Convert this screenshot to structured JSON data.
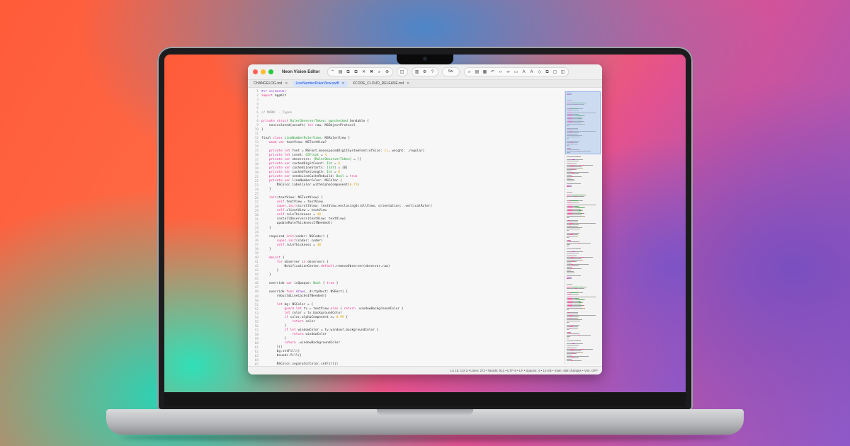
{
  "window": {
    "title": "Neon Vision Editor",
    "colors": {
      "close": "#ff5f57",
      "minimize": "#febc2e",
      "zoom": "#28c840"
    }
  },
  "toolbar": {
    "group_a": [
      "chevron-up-icon",
      "folder-icon",
      "copy-icon",
      "copy-icon",
      "trash-icon",
      "close-icon",
      "search-icon",
      "zoom-icon"
    ],
    "group_b": [
      "sidebar-icon"
    ],
    "group_c": [
      "split-icon",
      "gear-icon",
      "help-icon"
    ],
    "language": "Sw",
    "group_d": [
      "search-icon",
      "doc-icon",
      "book-icon",
      "undo-icon",
      "code-icon",
      "link-icon",
      "screen-icon",
      "text-a-icon",
      "text-a-icon",
      "eraser-icon",
      "copy-icon",
      "frame-icon",
      "sidebar-icon"
    ]
  },
  "tabs": [
    {
      "label": "CHANGELOG.md",
      "active": false
    },
    {
      "label": "LineNumberRulerView.swift",
      "active": true
    },
    {
      "label": "XCODE_CLOUD_RELEASE.md",
      "active": false
    }
  ],
  "code": [
    [
      [
        "pre",
        "#if os(macOS)"
      ]
    ],
    [
      [
        "kw",
        "import"
      ],
      [
        "p",
        " AppKit"
      ]
    ],
    [],
    [],
    [],
    [
      [
        "cm",
        "// MARK: - Types"
      ]
    ],
    [],
    [
      [
        "kw",
        "private struct"
      ],
      [
        "p",
        " "
      ],
      [
        "ty",
        "RulerObserverToken"
      ],
      [
        "p",
        ": "
      ],
      [
        "ty",
        "@unchecked"
      ],
      [
        "p",
        " Sendable {"
      ]
    ],
    [
      [
        "p",
        "    nonisolated(unsafe) "
      ],
      [
        "kw",
        "let"
      ],
      [
        "p",
        " raw: NSObjectProtocol"
      ]
    ],
    [
      [
        "p",
        "}"
      ]
    ],
    [],
    [
      [
        "p",
        "final "
      ],
      [
        "kw",
        "class"
      ],
      [
        "p",
        " "
      ],
      [
        "ty",
        "LineNumberRulerView"
      ],
      [
        "p",
        ": NSRulerView {"
      ]
    ],
    [
      [
        "p",
        "    "
      ],
      [
        "kw",
        "weak var"
      ],
      [
        "p",
        " textView: NSTextView?"
      ]
    ],
    [],
    [
      [
        "p",
        "    "
      ],
      [
        "kw",
        "private let"
      ],
      [
        "p",
        " font = NSFont.monospacedDigitSystemFont(ofSize: "
      ],
      [
        "num",
        "11"
      ],
      [
        "p",
        ", weight: .regular)"
      ]
    ],
    [
      [
        "p",
        "    "
      ],
      [
        "kw",
        "private let"
      ],
      [
        "p",
        " inset: "
      ],
      [
        "ty",
        "CGFloat"
      ],
      [
        "p",
        " = "
      ],
      [
        "num",
        "4"
      ]
    ],
    [
      [
        "p",
        "    "
      ],
      [
        "kw",
        "private var"
      ],
      [
        "p",
        " observers: "
      ],
      [
        "ty",
        "[RulerObserverToken]"
      ],
      [
        "p",
        " = []"
      ]
    ],
    [
      [
        "p",
        "    "
      ],
      [
        "kw",
        "private var"
      ],
      [
        "p",
        " cachedDigitCount: "
      ],
      [
        "ty",
        "Int"
      ],
      [
        "p",
        " = "
      ],
      [
        "num",
        "0"
      ]
    ],
    [
      [
        "p",
        "    "
      ],
      [
        "kw",
        "private var"
      ],
      [
        "p",
        " cachedLineStarts: "
      ],
      [
        "ty",
        "[Int]"
      ],
      [
        "p",
        " = [0]"
      ]
    ],
    [
      [
        "p",
        "    "
      ],
      [
        "kw",
        "private var"
      ],
      [
        "p",
        " cachedTextLength: "
      ],
      [
        "ty",
        "Int"
      ],
      [
        "p",
        " = "
      ],
      [
        "num",
        "0"
      ]
    ],
    [
      [
        "p",
        "    "
      ],
      [
        "kw",
        "private var"
      ],
      [
        "p",
        " needsLineCacheRebuild: "
      ],
      [
        "ty",
        "Bool"
      ],
      [
        "p",
        " = "
      ],
      [
        "kw",
        "true"
      ]
    ],
    [
      [
        "p",
        "    "
      ],
      [
        "kw",
        "private var"
      ],
      [
        "p",
        " lineNumberColor: NSColor {"
      ]
    ],
    [
      [
        "p",
        "        NSColor.labelColor.withAlphaComponent("
      ],
      [
        "num",
        "0.75"
      ],
      [
        "p",
        ")"
      ]
    ],
    [
      [
        "p",
        "    }"
      ]
    ],
    [],
    [
      [
        "p",
        "    "
      ],
      [
        "kw",
        "init"
      ],
      [
        "p",
        "(textView: NSTextView) {"
      ]
    ],
    [
      [
        "p",
        "        "
      ],
      [
        "kw",
        "self"
      ],
      [
        "p",
        ".textView = textView"
      ]
    ],
    [
      [
        "p",
        "        "
      ],
      [
        "kw",
        "super"
      ],
      [
        "p",
        "."
      ],
      [
        "kw",
        "init"
      ],
      [
        "p",
        "(scrollView: textView.enclosingScrollView, orientation: .verticalRuler)"
      ]
    ],
    [
      [
        "p",
        "        "
      ],
      [
        "kw",
        "self"
      ],
      [
        "p",
        ".clientView = textView"
      ]
    ],
    [
      [
        "p",
        "        "
      ],
      [
        "kw",
        "self"
      ],
      [
        "p",
        ".ruleThickness = "
      ],
      [
        "num",
        "40"
      ]
    ],
    [
      [
        "p",
        "        installObservers(textView: textView)"
      ]
    ],
    [
      [
        "p",
        "        updateRuleThicknessIfNeeded()"
      ]
    ],
    [
      [
        "p",
        "    }"
      ]
    ],
    [],
    [
      [
        "p",
        "    required "
      ],
      [
        "kw",
        "init"
      ],
      [
        "p",
        "(coder: NSCoder) {"
      ]
    ],
    [
      [
        "p",
        "        "
      ],
      [
        "kw",
        "super"
      ],
      [
        "p",
        "."
      ],
      [
        "kw",
        "init"
      ],
      [
        "p",
        "(coder: coder)"
      ]
    ],
    [
      [
        "p",
        "        "
      ],
      [
        "kw",
        "self"
      ],
      [
        "p",
        ".ruleThickness = "
      ],
      [
        "num",
        "40"
      ]
    ],
    [
      [
        "p",
        "    }"
      ]
    ],
    [],
    [
      [
        "p",
        "    "
      ],
      [
        "kw",
        "deinit"
      ],
      [
        "p",
        " {"
      ]
    ],
    [
      [
        "p",
        "        "
      ],
      [
        "kw",
        "for"
      ],
      [
        "p",
        " observer "
      ],
      [
        "kw",
        "in"
      ],
      [
        "p",
        " observers {"
      ]
    ],
    [
      [
        "p",
        "            NotificationCenter."
      ],
      [
        "kw",
        "default"
      ],
      [
        "p",
        ".removeObserver(observer.raw)"
      ]
    ],
    [
      [
        "p",
        "        }"
      ]
    ],
    [
      [
        "p",
        "    }"
      ]
    ],
    [],
    [
      [
        "p",
        "    override "
      ],
      [
        "kw",
        "var"
      ],
      [
        "p",
        " isOpaque: "
      ],
      [
        "ty",
        "Bool"
      ],
      [
        "p",
        " { "
      ],
      [
        "kw",
        "true"
      ],
      [
        "p",
        " }"
      ]
    ],
    [],
    [
      [
        "p",
        "    override "
      ],
      [
        "kw",
        "func"
      ],
      [
        "p",
        " "
      ],
      [
        "fn",
        "draw"
      ],
      [
        "p",
        "(_ dirtyRect: NSRect) {"
      ]
    ],
    [
      [
        "p",
        "        rebuildLineCacheIfNeeded()"
      ]
    ],
    [],
    [
      [
        "p",
        "        "
      ],
      [
        "kw",
        "let"
      ],
      [
        "p",
        " bg: NSColor = {"
      ]
    ],
    [
      [
        "p",
        "            "
      ],
      [
        "kw",
        "guard let"
      ],
      [
        "p",
        " tv = textView "
      ],
      [
        "kw",
        "else"
      ],
      [
        "p",
        " { "
      ],
      [
        "kw",
        "return"
      ],
      [
        "p",
        " .windowBackgroundColor }"
      ]
    ],
    [
      [
        "p",
        "            "
      ],
      [
        "kw",
        "let"
      ],
      [
        "p",
        " color = tv.backgroundColor"
      ]
    ],
    [
      [
        "p",
        "            "
      ],
      [
        "kw",
        "if"
      ],
      [
        "p",
        " color.alphaComponent >= "
      ],
      [
        "num",
        "0.99"
      ],
      [
        "p",
        " {"
      ]
    ],
    [
      [
        "p",
        "                "
      ],
      [
        "kw",
        "return"
      ],
      [
        "p",
        " color"
      ]
    ],
    [
      [
        "p",
        "            }"
      ]
    ],
    [
      [
        "p",
        "            "
      ],
      [
        "kw",
        "if let"
      ],
      [
        "p",
        " windowColor = tv.window?.backgroundColor {"
      ]
    ],
    [
      [
        "p",
        "                "
      ],
      [
        "kw",
        "return"
      ],
      [
        "p",
        " windowColor"
      ]
    ],
    [
      [
        "p",
        "            }"
      ]
    ],
    [
      [
        "p",
        "            "
      ],
      [
        "kw",
        "return"
      ],
      [
        "p",
        " .windowBackgroundColor"
      ]
    ],
    [
      [
        "p",
        "        }()"
      ]
    ],
    [
      [
        "p",
        "        bg.setFill()"
      ]
    ],
    [
      [
        "p",
        "        bounds.fill()"
      ]
    ],
    [],
    [
      [
        "p",
        "        NSColor.separatorColor.setFill()"
      ]
    ]
  ],
  "status": {
    "text": "Ln 10, Col 2 • Lines: 272 • Words: 912 • UTF-8 • LF • Spaces: 4 • 10 KB • main: 468 changes • Vim: OFF"
  },
  "minimap": {
    "viewport_fraction": 0.23
  }
}
